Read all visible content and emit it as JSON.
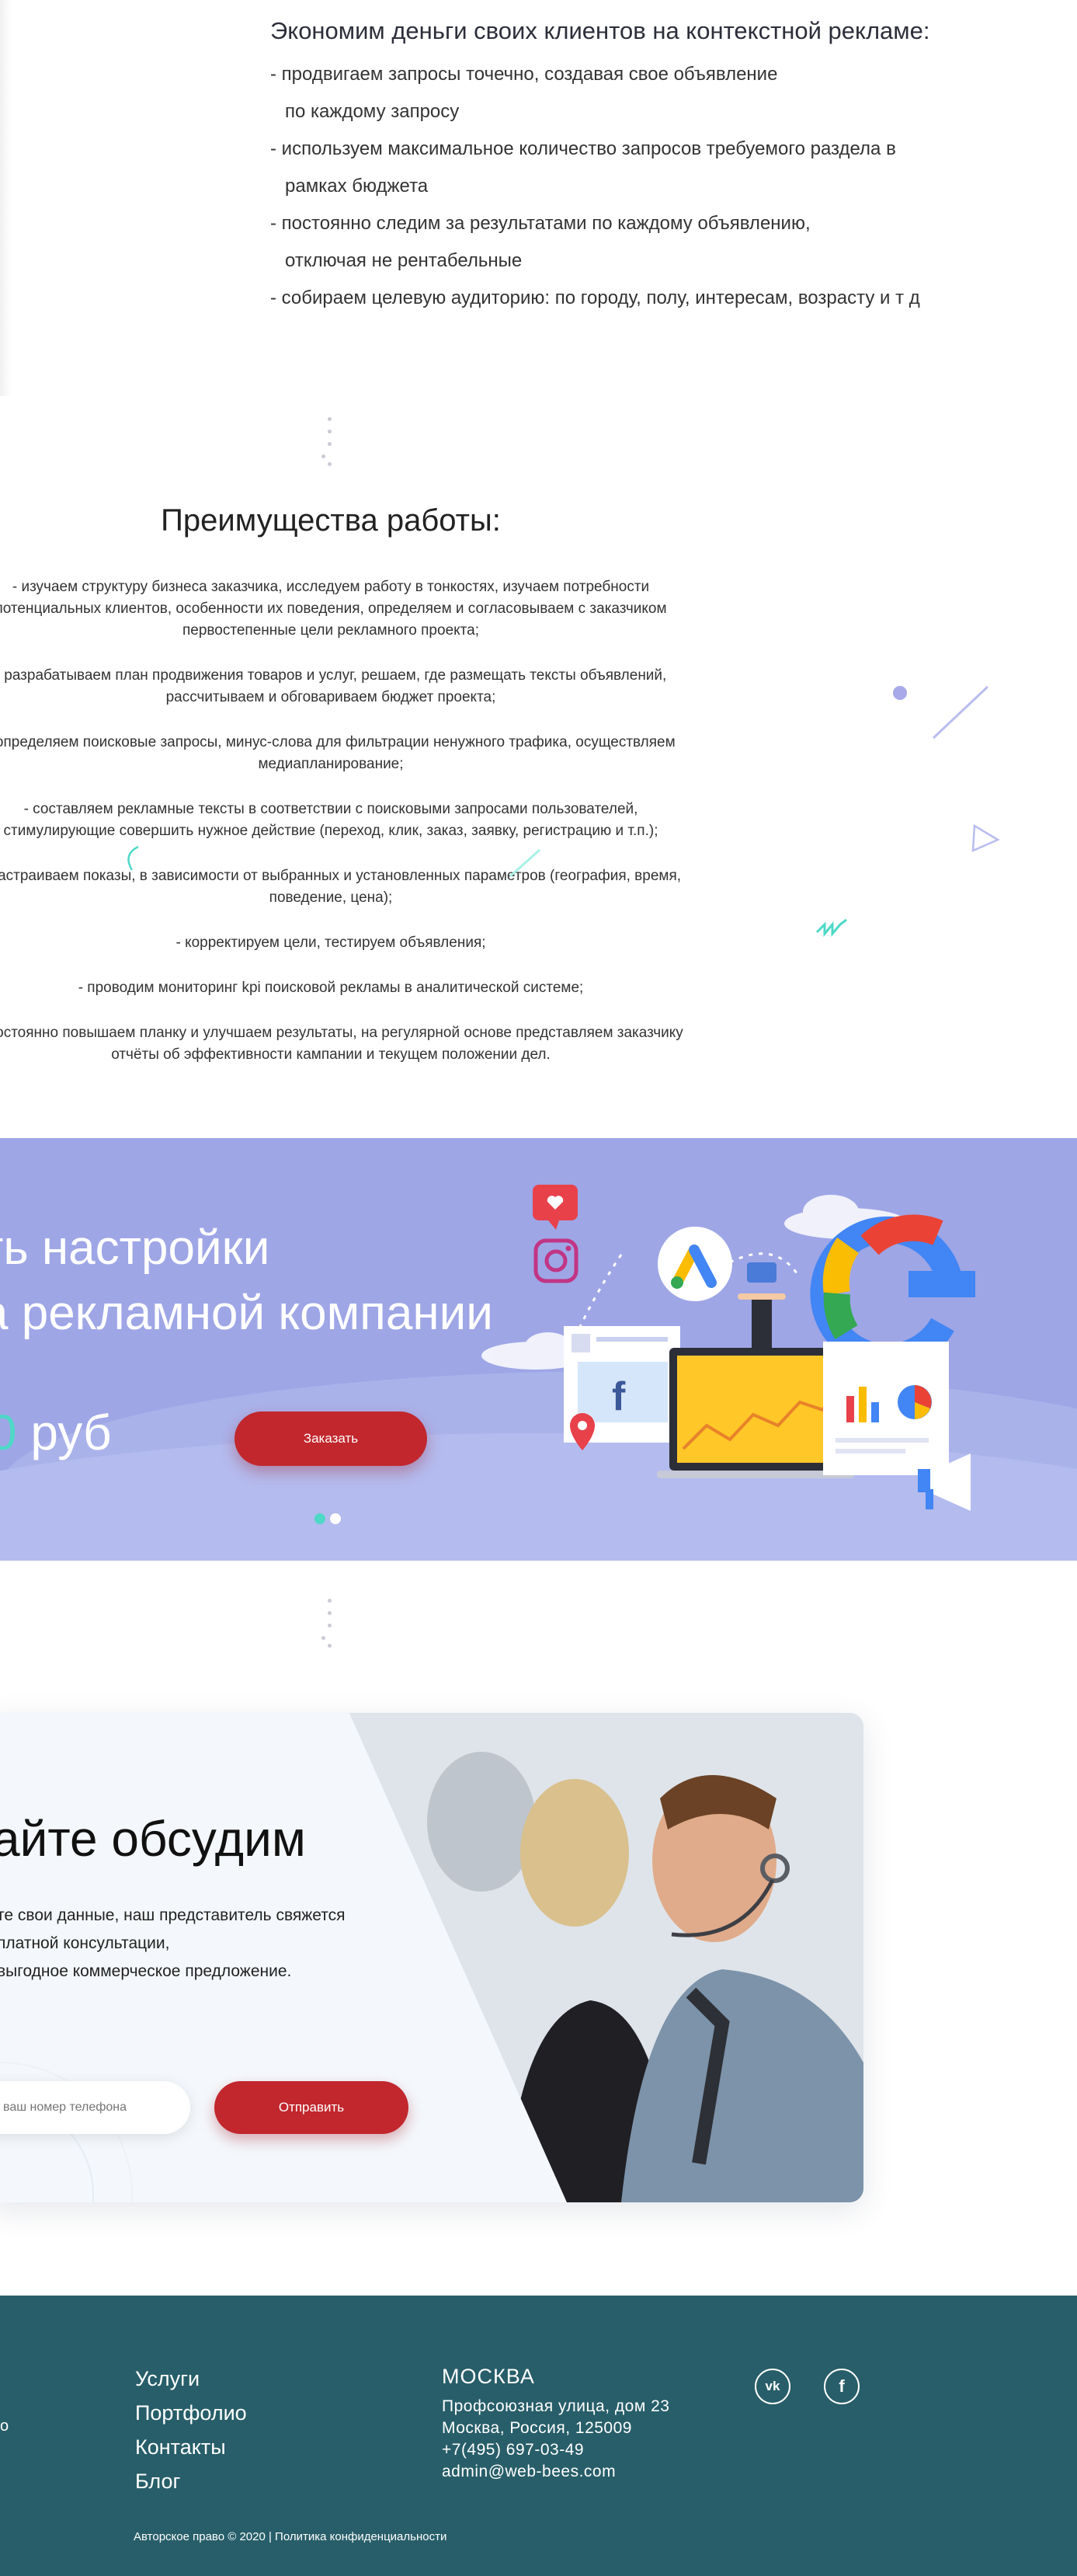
{
  "econ": {
    "title": "Экономим деньги своих клиентов на контекстной рекламе:",
    "lines": [
      "- продвигаем запросы точечно, создавая свое объявление",
      "  по каждому запросу",
      "- используем максимальное количество запросов требуемого раздела в",
      "  рамках бюджета",
      "- постоянно следим за результатами по каждому объявлению,",
      "  отключая не рентабельные",
      "- собираем целевую аудиторию: по городу, полу, интересам, возрасту и т д"
    ]
  },
  "advantages": {
    "title": "Преимущества работы:",
    "items": [
      "- изучаем структуру бизнеса заказчика, исследуем работу в тонкостях, изучаем потребности потенциальных клиентов, особенности их поведения, определяем и согласовываем с заказчиком первостепенные цели рекламного проекта;",
      "- разрабатываем план продвижения товаров и услуг, решаем, где размещать тексты объявлений, рассчитываем и обговариваем бюджет проекта;",
      "- определяем поисковые запросы, минус-слова для фильтрации ненужного трафика, осуществляем медиапланирование;",
      "- составляем рекламные тексты в соответствии с поисковыми запросами пользователей, стимулирующие совершить нужное действие (переход, клик, заказ, заявку, регистрацию и т.п.);",
      "- настраиваем показы, в зависимости от выбранных и установленных параметров (география, время, поведение, цена);",
      "- корректируем цели, тестируем объявления;",
      "- проводим мониторинг kpi поисковой рекламы в аналитической системе;",
      "- постоянно повышаем планку и улучшаем результаты, на регулярной основе представляем заказчику отчёты об эффективности кампании и текущем положении дел."
    ]
  },
  "banner": {
    "line1": "ть настройки",
    "line2": "а рекламной компании",
    "price_digit": "0",
    "price_unit": " руб",
    "order_label": "Заказать",
    "fb_letter": "f",
    "colors": {
      "bg": "#9ea6e6",
      "accent": "#4fd8c7",
      "button": "#c1272d"
    }
  },
  "contact": {
    "title": "айте обсудим",
    "text_lines": [
      "те свои данные, наш представитель свяжется",
      "платной консультации,",
      "выгодное коммерческое предложение."
    ],
    "phone_placeholder": "ваш номер телефона",
    "send_label": "Отправить"
  },
  "footer": {
    "left_cut": "о",
    "nav": [
      "Услуги",
      "Портфолио",
      "Контакты",
      "Блог"
    ],
    "city": "МОСКВА",
    "address_lines": [
      "Профсоюзная улица, дом 23",
      "Москва, Россия, 125009",
      "+7(495) 697-03-49",
      "admin@web-bees.com"
    ],
    "social": [
      {
        "icon": "vk-icon",
        "glyph": "vk"
      },
      {
        "icon": "facebook-icon",
        "glyph": "f"
      }
    ],
    "copyright": "Авторское право © 2020 | Политика конфиденциальности"
  }
}
